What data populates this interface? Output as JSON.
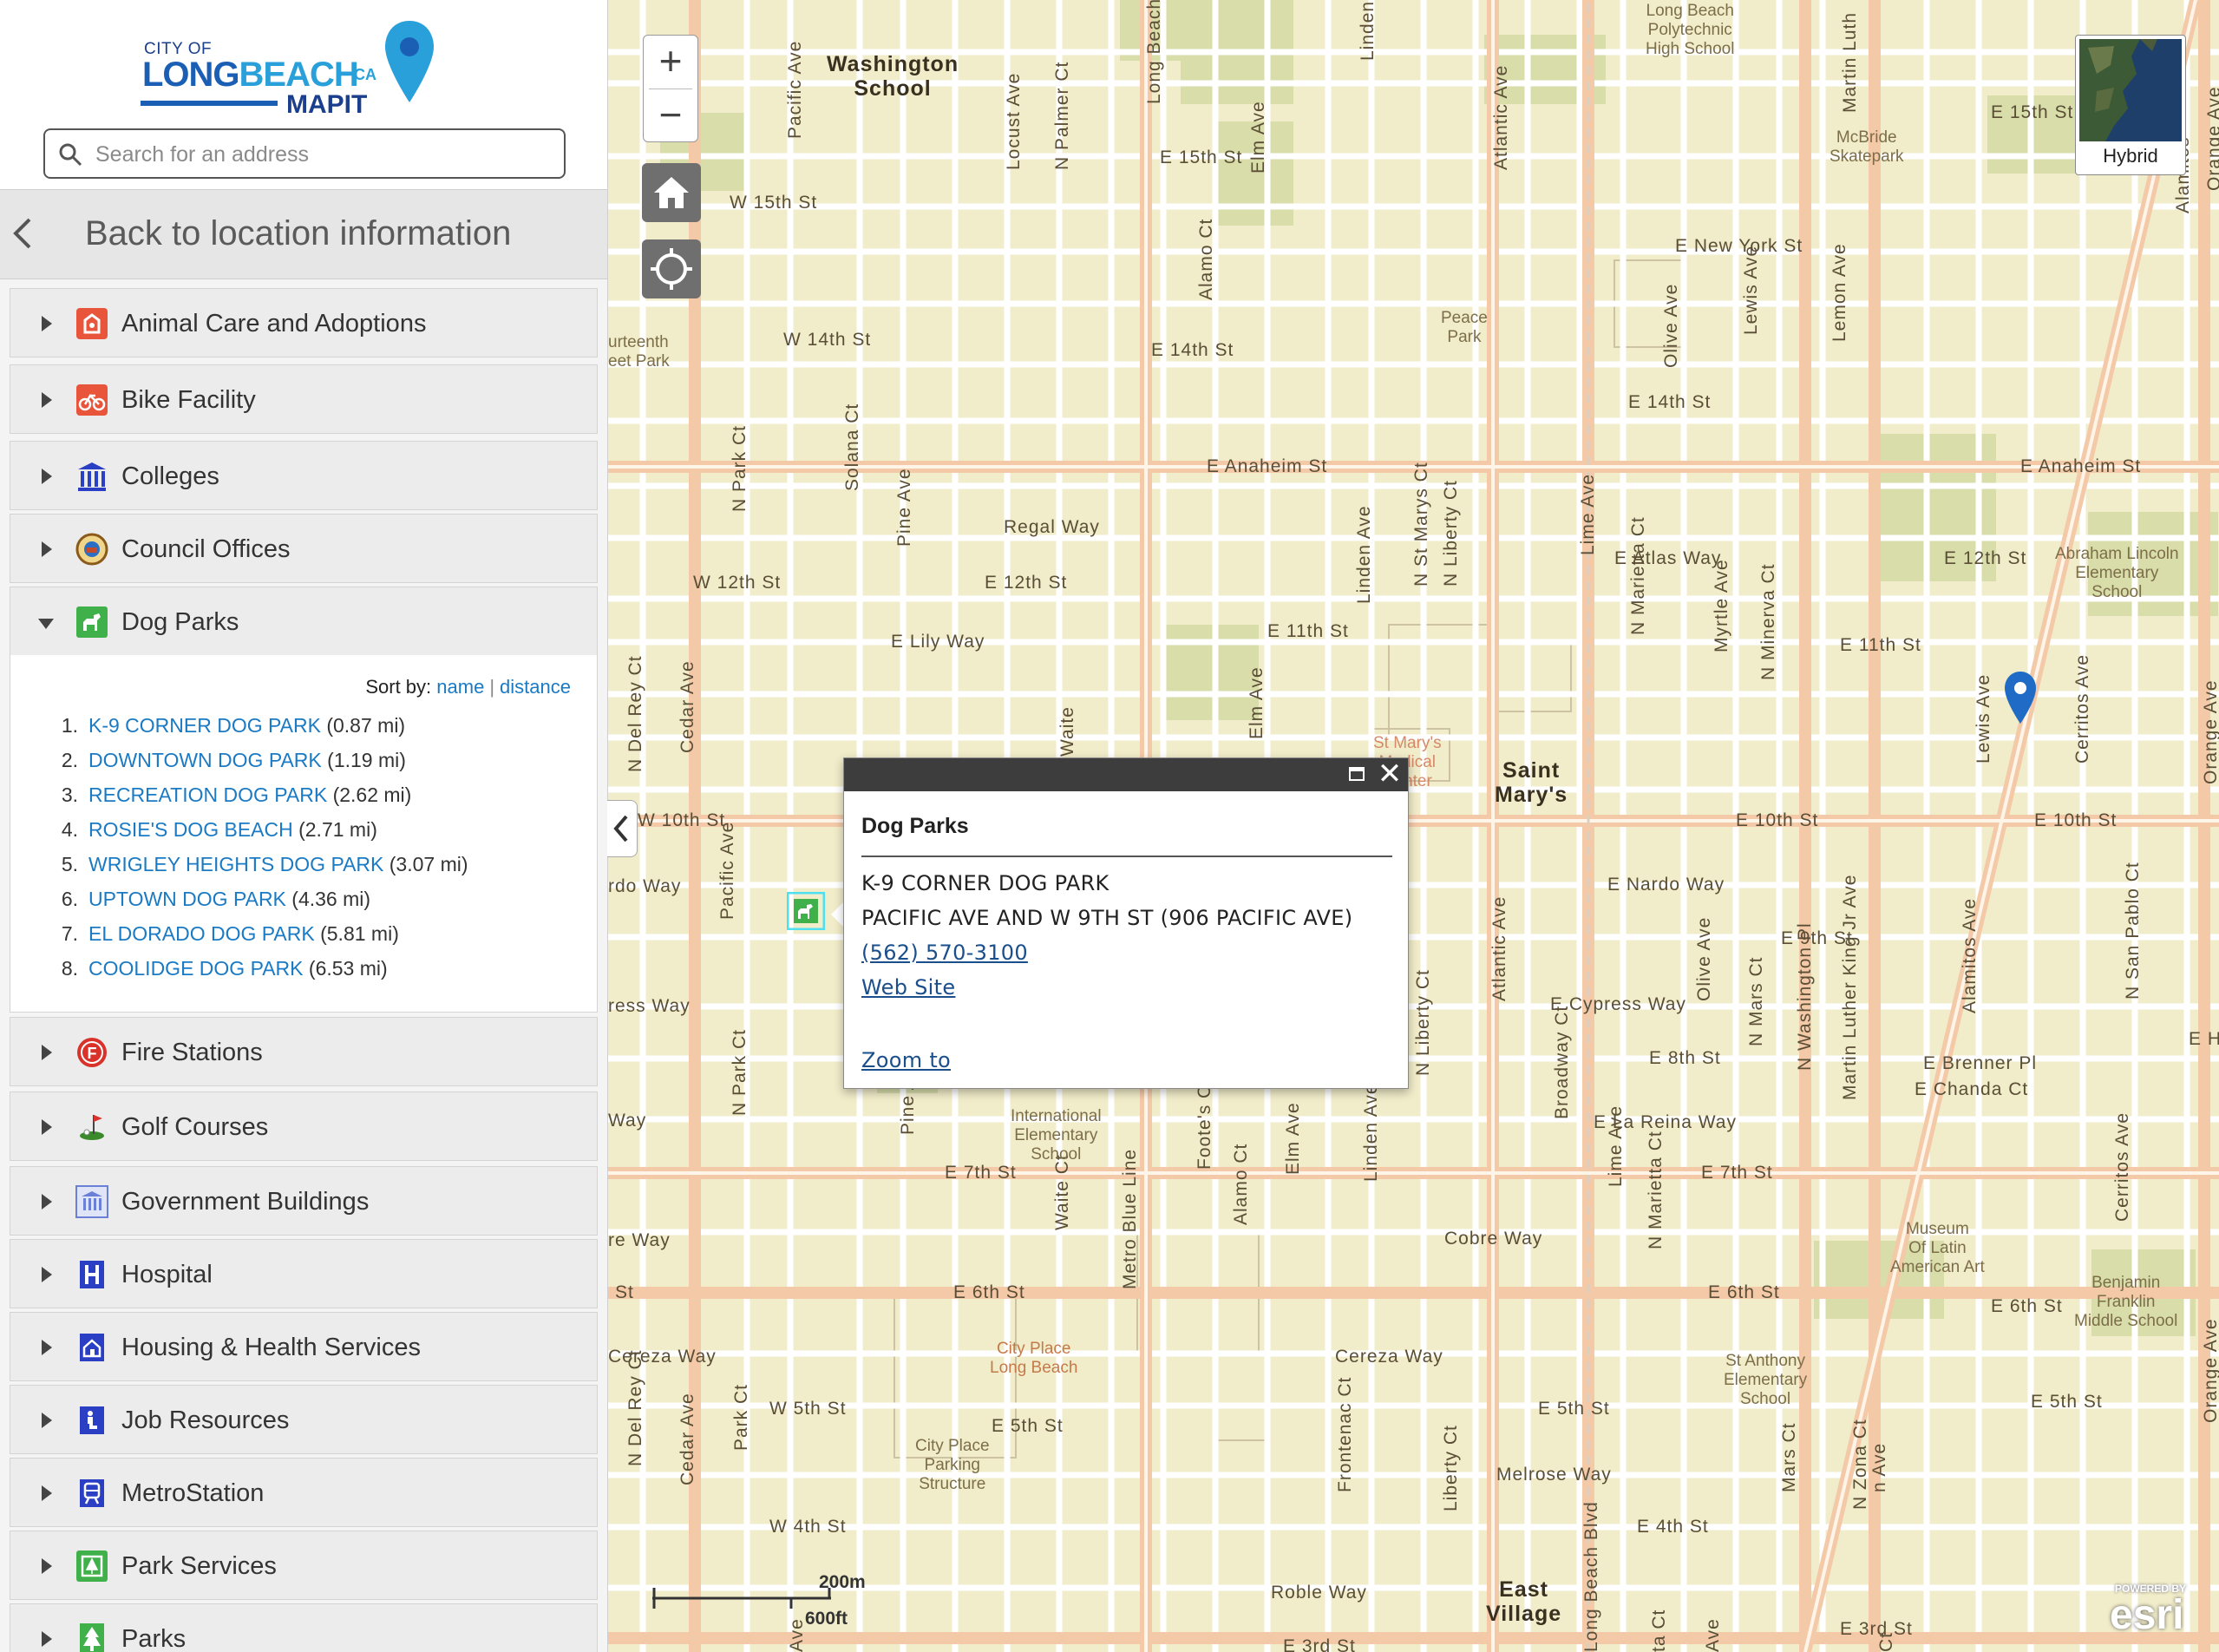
{
  "brand": {
    "line1": "CITY OF",
    "line2a": "LONG",
    "line2b": "BEACH",
    "ca": "CA",
    "line3": "MAPIT"
  },
  "search": {
    "placeholder": "Search for an address"
  },
  "back": {
    "label": "Back to location information"
  },
  "categories_top": [
    {
      "label": "Animal Care and Adoptions",
      "icon": "animal-care-icon",
      "color": "#e8553b"
    },
    {
      "label": "Bike Facility",
      "icon": "bike-icon",
      "color": "#e8553b"
    },
    {
      "label": "Colleges",
      "icon": "college-icon",
      "color": "#2b3fc4"
    },
    {
      "label": "Council Offices",
      "icon": "city-seal-icon",
      "color": "#c46a2b"
    },
    {
      "label": "Dog Parks",
      "icon": "dog-park-icon",
      "color": "#3fb04a"
    }
  ],
  "dog_parks": {
    "sort_label": "Sort by:",
    "sort_name": "name",
    "sort_distance": "distance",
    "items": [
      {
        "n": "1.",
        "name": "K-9 CORNER DOG PARK",
        "dist": "(0.87 mi)"
      },
      {
        "n": "2.",
        "name": "DOWNTOWN DOG PARK",
        "dist": "(1.19 mi)"
      },
      {
        "n": "3.",
        "name": "RECREATION DOG PARK",
        "dist": "(2.62 mi)"
      },
      {
        "n": "4.",
        "name": "ROSIE'S DOG BEACH",
        "dist": "(2.71 mi)"
      },
      {
        "n": "5.",
        "name": "WRIGLEY HEIGHTS DOG PARK",
        "dist": "(3.07 mi)"
      },
      {
        "n": "6.",
        "name": "UPTOWN DOG PARK",
        "dist": "(4.36 mi)"
      },
      {
        "n": "7.",
        "name": "EL DORADO DOG PARK",
        "dist": "(5.81 mi)"
      },
      {
        "n": "8.",
        "name": "COOLIDGE DOG PARK",
        "dist": "(6.53 mi)"
      }
    ]
  },
  "categories_bottom": [
    {
      "label": "Fire Stations",
      "icon": "fire-station-icon",
      "color": "#d8322b"
    },
    {
      "label": "Golf Courses",
      "icon": "golf-icon",
      "color": "#3a8a2b"
    },
    {
      "label": "Government Buildings",
      "icon": "government-building-icon",
      "color": "#6a7fd6"
    },
    {
      "label": "Hospital",
      "icon": "hospital-icon",
      "color": "#2b3fc4"
    },
    {
      "label": "Housing & Health Services",
      "icon": "housing-icon",
      "color": "#2b3fc4"
    },
    {
      "label": "Job Resources",
      "icon": "job-icon",
      "color": "#2b3fc4"
    },
    {
      "label": "MetroStation",
      "icon": "metro-icon",
      "color": "#2b3fc4"
    },
    {
      "label": "Park Services",
      "icon": "park-services-icon",
      "color": "#3fb04a"
    },
    {
      "label": "Parks",
      "icon": "tree-icon",
      "color": "#3fb04a"
    }
  ],
  "popup": {
    "title": "Dog Parks",
    "name": "K-9 CORNER DOG PARK",
    "address": "PACIFIC AVE AND W 9TH ST (906 PACIFIC AVE)",
    "phone": "(562) 570-3100",
    "website": "Web Site",
    "zoom": "Zoom to"
  },
  "basemap": {
    "label": "Hybrid"
  },
  "scale": {
    "metric": "200m",
    "imperial": "600ft"
  },
  "attribution": {
    "powered": "POWERED BY",
    "brand": "esri"
  },
  "map_labels": {
    "streets_h": [
      {
        "t": "W 15th St"
      },
      {
        "t": "E 15th St"
      },
      {
        "t": "E 15th St"
      },
      {
        "t": "E New York St"
      },
      {
        "t": "W 14th St"
      },
      {
        "t": "E 14th St"
      },
      {
        "t": "E 14th St"
      },
      {
        "t": "E Anaheim St"
      },
      {
        "t": "E Anaheim St"
      },
      {
        "t": "Regal Way"
      },
      {
        "t": "W 12th St"
      },
      {
        "t": "E 12th St"
      },
      {
        "t": "E Atlas Way"
      },
      {
        "t": "E 12th St"
      },
      {
        "t": "E Lily Way"
      },
      {
        "t": "E 11th St"
      },
      {
        "t": "E 11th St"
      },
      {
        "t": "W 10th St"
      },
      {
        "t": "E 10th St"
      },
      {
        "t": "E 10th St"
      },
      {
        "t": "rdo Way"
      },
      {
        "t": "E Nardo Way"
      },
      {
        "t": "E 9th St"
      },
      {
        "t": "ress Way"
      },
      {
        "t": "E Cypress Way"
      },
      {
        "t": "E 8th St"
      },
      {
        "t": "E Brenner Pl"
      },
      {
        "t": "E Chanda Ct"
      },
      {
        "t": "Way"
      },
      {
        "t": "E La Reina Way"
      },
      {
        "t": "E 7th St"
      },
      {
        "t": "E 7th St"
      },
      {
        "t": "re Way"
      },
      {
        "t": "Cobre Way"
      },
      {
        "t": "St"
      },
      {
        "t": "E 6th St"
      },
      {
        "t": "E 6th St"
      },
      {
        "t": "E 6th St"
      },
      {
        "t": "Cereza Way"
      },
      {
        "t": "Cereza Way"
      },
      {
        "t": "W 5th St"
      },
      {
        "t": "E 5th St"
      },
      {
        "t": "E 5th St"
      },
      {
        "t": "E 5th St"
      },
      {
        "t": "Melrose Way"
      },
      {
        "t": "W 4th St"
      },
      {
        "t": "E 4th St"
      },
      {
        "t": "Roble Way"
      },
      {
        "t": "E 3rd St"
      },
      {
        "t": "E 3rd St"
      },
      {
        "t": "E He"
      }
    ],
    "streets_v": [
      {
        "t": "Pacific Ave"
      },
      {
        "t": "Locust Ave"
      },
      {
        "t": "N Palmer Ct"
      },
      {
        "t": "Long Beach"
      },
      {
        "t": "Elm Ave"
      },
      {
        "t": "Linden"
      },
      {
        "t": "Atlantic Ave"
      },
      {
        "t": "Martin Luth"
      },
      {
        "t": "Alamitos"
      },
      {
        "t": "Orange Ave"
      },
      {
        "t": "Alamo Ct"
      },
      {
        "t": "Olive Ave"
      },
      {
        "t": "Lewis Ave"
      },
      {
        "t": "Lemon Ave"
      },
      {
        "t": "N Park Ct"
      },
      {
        "t": "Solana Ct"
      },
      {
        "t": "Pine Ave"
      },
      {
        "t": "Linden Ave"
      },
      {
        "t": "N St Marys Ct"
      },
      {
        "t": "N Liberty Ct"
      },
      {
        "t": "Lime Ave"
      },
      {
        "t": "N Marietta Ct"
      },
      {
        "t": "Myrtle Ave"
      },
      {
        "t": "N Minerva Ct"
      },
      {
        "t": "N Del Rey Ct"
      },
      {
        "t": "Cedar Ave"
      },
      {
        "t": "Waite"
      },
      {
        "t": "Elm Ave"
      },
      {
        "t": "Lewis Ave"
      },
      {
        "t": "Cerritos Ave"
      },
      {
        "t": "Orange Ave"
      },
      {
        "t": "N San Pablo Ct"
      },
      {
        "t": "Alamitos Ave"
      },
      {
        "t": "Pacific Ave"
      },
      {
        "t": "Martin Luther King Jr Ave"
      },
      {
        "t": "N Washington Pl"
      },
      {
        "t": "N Mars Ct"
      },
      {
        "t": "Olive Ave"
      },
      {
        "t": "Atlantic Ave"
      },
      {
        "t": "N Liberty Ct"
      },
      {
        "t": "Broadway Ct"
      },
      {
        "t": "Lime Ave"
      },
      {
        "t": "N Marietta Ct"
      },
      {
        "t": "N Park Ct"
      },
      {
        "t": "Pine Ave"
      },
      {
        "t": "Waite Ct"
      },
      {
        "t": "Metro Blue Line"
      },
      {
        "t": "Foote's Ct"
      },
      {
        "t": "Alamo Ct"
      },
      {
        "t": "Elm Ave"
      },
      {
        "t": "Linden Ave"
      },
      {
        "t": "Cerritos Ave"
      },
      {
        "t": "Orange Ave"
      },
      {
        "t": "N Del Rey Ct"
      },
      {
        "t": "Cedar Ave"
      },
      {
        "t": "Park Ct"
      },
      {
        "t": "Frontenac Ct"
      },
      {
        "t": "Liberty Ct"
      },
      {
        "t": "Mars Ct"
      },
      {
        "t": "N Zona Ct"
      },
      {
        "t": "n Ave"
      },
      {
        "t": "Long Beach Blvd"
      },
      {
        "t": "Ave"
      },
      {
        "t": "Ct"
      },
      {
        "t": "ta Ct"
      },
      {
        "t": "Ave"
      }
    ],
    "poi": [
      {
        "t": "Washington\nSchool",
        "hood": true
      },
      {
        "t": "Long Beach\nPolytechnic\nHigh School"
      },
      {
        "t": "McBride\nSkatepark"
      },
      {
        "t": "Peace\nPark"
      },
      {
        "t": "urteenth\neet Park"
      },
      {
        "t": "Abraham Lincoln\nElementary\nSchool"
      },
      {
        "t": "St Mary's\nMedical\nCenter"
      },
      {
        "t": "Saint\nMary's",
        "hood": true
      },
      {
        "t": "International\nElementary\nSchool"
      },
      {
        "t": "Museum\nOf Latin\nAmerican Art"
      },
      {
        "t": "Benjamin\nFranklin\nMiddle School"
      },
      {
        "t": "City Place\nLong Beach"
      },
      {
        "t": "St Anthony\nElementary\nSchool"
      },
      {
        "t": "City Place\nParking\nStructure"
      },
      {
        "t": "East\nVillage",
        "hood": true
      }
    ]
  }
}
